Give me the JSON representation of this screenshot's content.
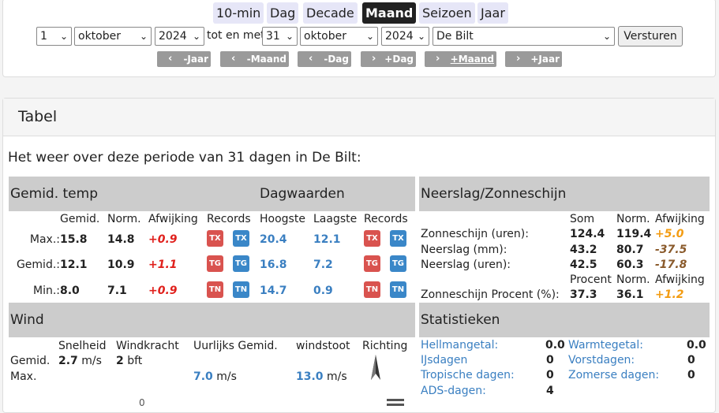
{
  "period_tabs": [
    "10-min",
    "Dag",
    "Decade",
    "Maand",
    "Seizoen",
    "Jaar"
  ],
  "active_tab": "Maand",
  "range": {
    "from_day": "1",
    "from_month": "oktober",
    "from_year": "2024",
    "to_text": "tot en met",
    "to_day": "31",
    "to_month": "oktober",
    "to_year": "2024",
    "station": "De Bilt",
    "submit": "Versturen"
  },
  "nav": [
    "-Jaar",
    "-Maand",
    "-Dag",
    "+Dag",
    "+Maand",
    "+Jaar"
  ],
  "panel_title": "Tabel",
  "intro": "Het weer over deze periode van 31 dagen in De Bilt:",
  "temp": {
    "head_left": "Gemid. temp",
    "head_right": "Dagwaarden",
    "cols": [
      "Gemid.",
      "Norm.",
      "Afwijking",
      "Records",
      "Hoogste",
      "Laagste",
      "Records"
    ],
    "rows": [
      {
        "label": "Max.:",
        "gemid": "15.8",
        "norm": "14.8",
        "afw": "+0.9",
        "code": "TX",
        "hoogste": "20.4",
        "laagste": "12.1"
      },
      {
        "label": "Gemid.:",
        "gemid": "12.1",
        "norm": "10.9",
        "afw": "+1.1",
        "code": "TG",
        "hoogste": "16.8",
        "laagste": "7.2"
      },
      {
        "label": "Min.:",
        "gemid": "8.0",
        "norm": "7.1",
        "afw": "+0.9",
        "code": "TN",
        "hoogste": "14.7",
        "laagste": "0.9"
      }
    ]
  },
  "rain": {
    "head": "Neerslag/Zonneschijn",
    "cols1": [
      "Som",
      "Norm.",
      "Afwijking"
    ],
    "rows1": [
      {
        "label": "Zonneschijn (uren):",
        "som": "124.4",
        "norm": "119.4",
        "afw": "+5.0",
        "tone": "orange"
      },
      {
        "label": "Neerslag (mm):",
        "som": "43.2",
        "norm": "80.7",
        "afw": "-37.5",
        "tone": "brown"
      },
      {
        "label": "Neerslag (uren):",
        "som": "42.5",
        "norm": "60.3",
        "afw": "-17.8",
        "tone": "brown"
      }
    ],
    "cols2": [
      "Procent",
      "Norm.",
      "Afwijking"
    ],
    "row2": {
      "label": "Zonneschijn Procent (%):",
      "som": "37.3",
      "norm": "36.1",
      "afw": "+1.2"
    }
  },
  "wind": {
    "head": "Wind",
    "cols": [
      "Snelheid",
      "Windkracht",
      "Uurlijks Gemid.",
      "windstoot",
      "Richting"
    ],
    "gemid_label": "Gemid.",
    "max_label": "Max.",
    "speed_val": "2.7",
    "speed_unit": "m/s",
    "kracht_val": "2",
    "kracht_unit": "bft",
    "hourly_val": "7.0",
    "hourly_unit": "m/s",
    "gust_val": "13.0",
    "gust_unit": "m/s",
    "partial": "0"
  },
  "stats": {
    "head": "Statistieken",
    "left": [
      {
        "label": "Hellmangetal:",
        "value": "0.0"
      },
      {
        "label": "IJsdagen",
        "value": "0"
      },
      {
        "label": "Tropische dagen:",
        "value": "0"
      },
      {
        "label": "ADS-dagen:",
        "value": "4"
      }
    ],
    "right": [
      {
        "label": "Warmtegetal:",
        "value": "0.0"
      },
      {
        "label": "Vorstdagen:",
        "value": "0"
      },
      {
        "label": "Zomerse dagen:",
        "value": "0"
      }
    ]
  },
  "colors": {
    "accent": "#3a7fc1",
    "positive": "#e0201c",
    "sun": "#f39c12",
    "deficit": "#8a5a2b",
    "badge_red": "#d9534f",
    "badge_blue": "#3a87c8"
  }
}
